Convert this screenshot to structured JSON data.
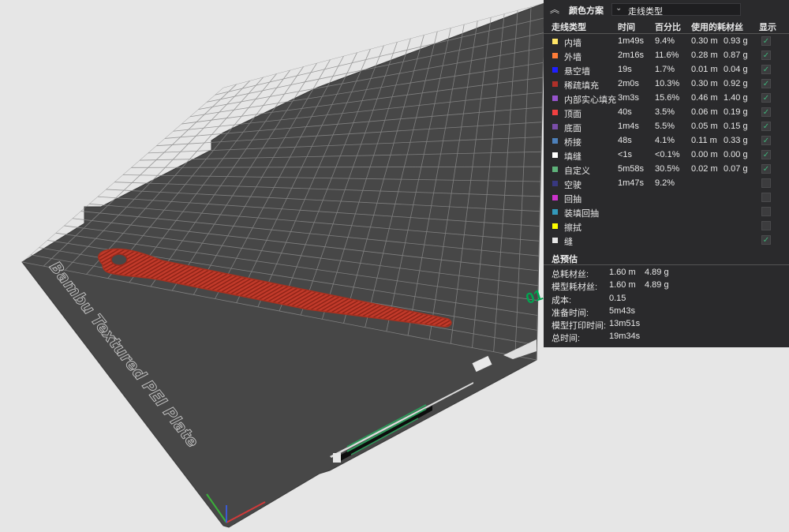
{
  "legend": {
    "title": "颜色方案",
    "view_mode": "走线类型",
    "columns": {
      "type": "走线类型",
      "time": "时间",
      "percent": "百分比",
      "filament": "使用的耗材丝",
      "show": "显示"
    },
    "rows": [
      {
        "name": "内墙",
        "color": "#ffe566",
        "time": "1m49s",
        "percent": "9.4%",
        "meters": "0.30 m",
        "grams": "0.93 g",
        "show": true
      },
      {
        "name": "外墙",
        "color": "#ff7d38",
        "time": "2m16s",
        "percent": "11.6%",
        "meters": "0.28 m",
        "grams": "0.87 g",
        "show": true
      },
      {
        "name": "悬空墙",
        "color": "#1f1fff",
        "time": "19s",
        "percent": "1.7%",
        "meters": "0.01 m",
        "grams": "0.04 g",
        "show": true
      },
      {
        "name": "稀疏填充",
        "color": "#b03029",
        "time": "2m0s",
        "percent": "10.3%",
        "meters": "0.30 m",
        "grams": "0.92 g",
        "show": true
      },
      {
        "name": "内部实心填充",
        "color": "#9654cc",
        "time": "3m3s",
        "percent": "15.6%",
        "meters": "0.46 m",
        "grams": "1.40 g",
        "show": true
      },
      {
        "name": "顶面",
        "color": "#f04040",
        "time": "40s",
        "percent": "3.5%",
        "meters": "0.06 m",
        "grams": "0.19 g",
        "show": true
      },
      {
        "name": "底面",
        "color": "#7a4da8",
        "time": "1m4s",
        "percent": "5.5%",
        "meters": "0.05 m",
        "grams": "0.15 g",
        "show": true
      },
      {
        "name": "桥接",
        "color": "#4d80ba",
        "time": "48s",
        "percent": "4.1%",
        "meters": "0.11 m",
        "grams": "0.33 g",
        "show": true
      },
      {
        "name": "填缝",
        "color": "#ffffff",
        "time": "<1s",
        "percent": "<0.1%",
        "meters": "0.00 m",
        "grams": "0.00 g",
        "show": true
      },
      {
        "name": "自定义",
        "color": "#5eb27a",
        "time": "5m58s",
        "percent": "30.5%",
        "meters": "0.02 m",
        "grams": "0.07 g",
        "show": true
      },
      {
        "name": "空驶",
        "color": "#383880",
        "time": "1m47s",
        "percent": "9.2%",
        "meters": "",
        "grams": "",
        "show": false
      },
      {
        "name": "回抽",
        "color": "#cc33cc",
        "time": "",
        "percent": "",
        "meters": "",
        "grams": "",
        "show": false
      },
      {
        "name": "装填回抽",
        "color": "#3399bb",
        "time": "",
        "percent": "",
        "meters": "",
        "grams": "",
        "show": false
      },
      {
        "name": "擦拭",
        "color": "#ffff00",
        "time": "",
        "percent": "",
        "meters": "",
        "grams": "",
        "show": false
      },
      {
        "name": "缝",
        "color": "#e6e6e6",
        "time": "",
        "percent": "",
        "meters": "",
        "grams": "",
        "show": true
      }
    ]
  },
  "estimate": {
    "title": "总预估",
    "rows": [
      {
        "label": "总耗材丝:",
        "v1": "1.60 m",
        "v2": "4.89 g"
      },
      {
        "label": "模型耗材丝:",
        "v1": "1.60 m",
        "v2": "4.89 g"
      },
      {
        "label": "成本:",
        "v1": "0.15",
        "v2": ""
      },
      {
        "label": "准备时间:",
        "v1": "5m43s",
        "v2": ""
      },
      {
        "label": "模型打印时间:",
        "v1": "13m51s",
        "v2": ""
      },
      {
        "label": "总时间:",
        "v1": "19m34s",
        "v2": ""
      }
    ]
  },
  "plate": {
    "label": "Bambu Textured PEI Plate",
    "number": "01"
  },
  "colors": {
    "plate": "#474747",
    "grid": "#8a8a8a",
    "model": "#c0392b",
    "check": "#3fb27a",
    "panel": "#2a2a2c",
    "plate_number": "#00a651"
  }
}
